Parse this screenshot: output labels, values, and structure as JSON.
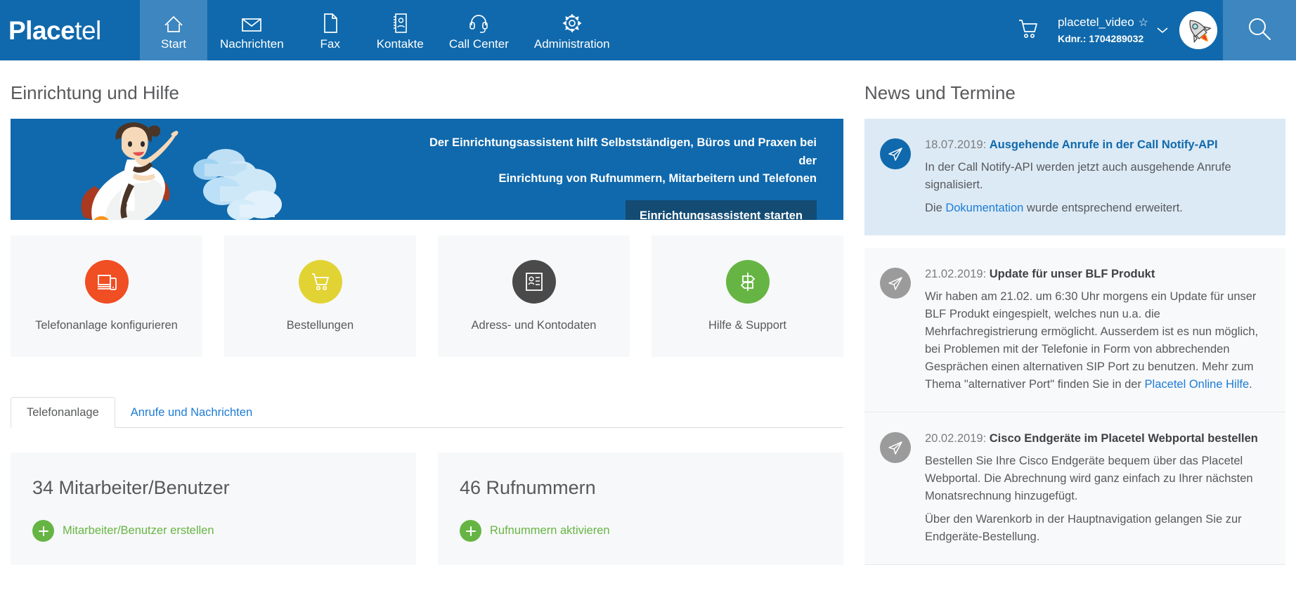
{
  "brand": {
    "name_bold": "Place",
    "name_light": "tel"
  },
  "nav": {
    "items": [
      {
        "label": "Start",
        "icon": "home-icon",
        "active": true
      },
      {
        "label": "Nachrichten",
        "icon": "envelope-icon",
        "active": false
      },
      {
        "label": "Fax",
        "icon": "document-icon",
        "active": false
      },
      {
        "label": "Kontakte",
        "icon": "contact-book-icon",
        "active": false
      },
      {
        "label": "Call Center",
        "icon": "headset-icon",
        "active": false
      },
      {
        "label": "Administration",
        "icon": "gear-icon",
        "active": false
      }
    ]
  },
  "account": {
    "name": "placetel_video",
    "star": "☆",
    "kdnr": "Kdnr.: 1704289032"
  },
  "left": {
    "section_title": "Einrichtung und Hilfe",
    "banner": {
      "line1": "Der Einrichtungsassistent hilft Selbstständigen, Büros und Praxen bei der",
      "line2": "Einrichtung von Rufnummern, Mitarbeitern und Telefonen",
      "button": "Einrichtungsassistent starten"
    },
    "tiles": [
      {
        "label": "Telefonanlage konfigurieren",
        "color": "#f04e23",
        "icon": "devices-icon"
      },
      {
        "label": "Bestellungen",
        "color": "#e2d335",
        "icon": "cart-icon"
      },
      {
        "label": "Adress- und Kontodaten",
        "color": "#4a4a4a",
        "icon": "id-card-icon"
      },
      {
        "label": "Hilfe & Support",
        "color": "#66b544",
        "icon": "signpost-icon"
      }
    ],
    "tabs": [
      {
        "label": "Telefonanlage",
        "active": true
      },
      {
        "label": "Anrufe und Nachrichten",
        "active": false
      }
    ],
    "stats": [
      {
        "title": "34 Mitarbeiter/Benutzer",
        "action": "Mitarbeiter/Benutzer erstellen"
      },
      {
        "title": "46 Rufnummern",
        "action": "Rufnummern aktivieren"
      }
    ]
  },
  "right": {
    "section_title": "News und Termine",
    "news": [
      {
        "highlight": true,
        "icon_color": "blue",
        "date": "18.07.2019:",
        "title": "Ausgehende Anrufe in der Call Notify-API",
        "title_style": "link",
        "paragraphs": [
          {
            "pre": "In der Call Notify-API werden jetzt auch ausgehende Anrufe signalisiert.",
            "link": "",
            "post": ""
          },
          {
            "pre": "Die ",
            "link": "Dokumentation",
            "post": " wurde entsprechend erweitert."
          }
        ]
      },
      {
        "highlight": false,
        "icon_color": "grey",
        "date": "21.02.2019:",
        "title": "Update für unser BLF Produkt",
        "title_style": "dark",
        "paragraphs": [
          {
            "pre": "Wir haben am 21.02. um 6:30 Uhr morgens ein Update für unser BLF Produkt eingespielt, welches nun u.a. die Mehrfachregistrierung ermöglicht. Ausserdem ist es nun möglich, bei Problemen mit der Telefonie in Form von abbrechenden Gesprächen einen alternativen SIP Port zu benutzen. Mehr zum Thema \"alternativer Port\" finden Sie in der ",
            "link": "Placetel Online Hilfe",
            "post": "."
          }
        ]
      },
      {
        "highlight": false,
        "icon_color": "grey",
        "date": "20.02.2019:",
        "title": "Cisco Endgeräte im Placetel Webportal bestellen",
        "title_style": "dark",
        "paragraphs": [
          {
            "pre": "Bestellen Sie Ihre Cisco Endgeräte bequem über das Placetel Webportal. Die Abrechnung wird ganz einfach zu Ihrer nächsten Monatsrechnung hinzugefügt.",
            "link": "",
            "post": ""
          },
          {
            "pre": "Über den Warenkorb in der Hauptnavigation gelangen Sie zur Endgeräte-Bestellung.",
            "link": "",
            "post": ""
          }
        ]
      }
    ]
  },
  "colors": {
    "header_blue": "#1069ac",
    "active_nav": "#3d86bf",
    "banner_btn": "#134b73",
    "green": "#66b544",
    "link": "#1c7cd6"
  }
}
